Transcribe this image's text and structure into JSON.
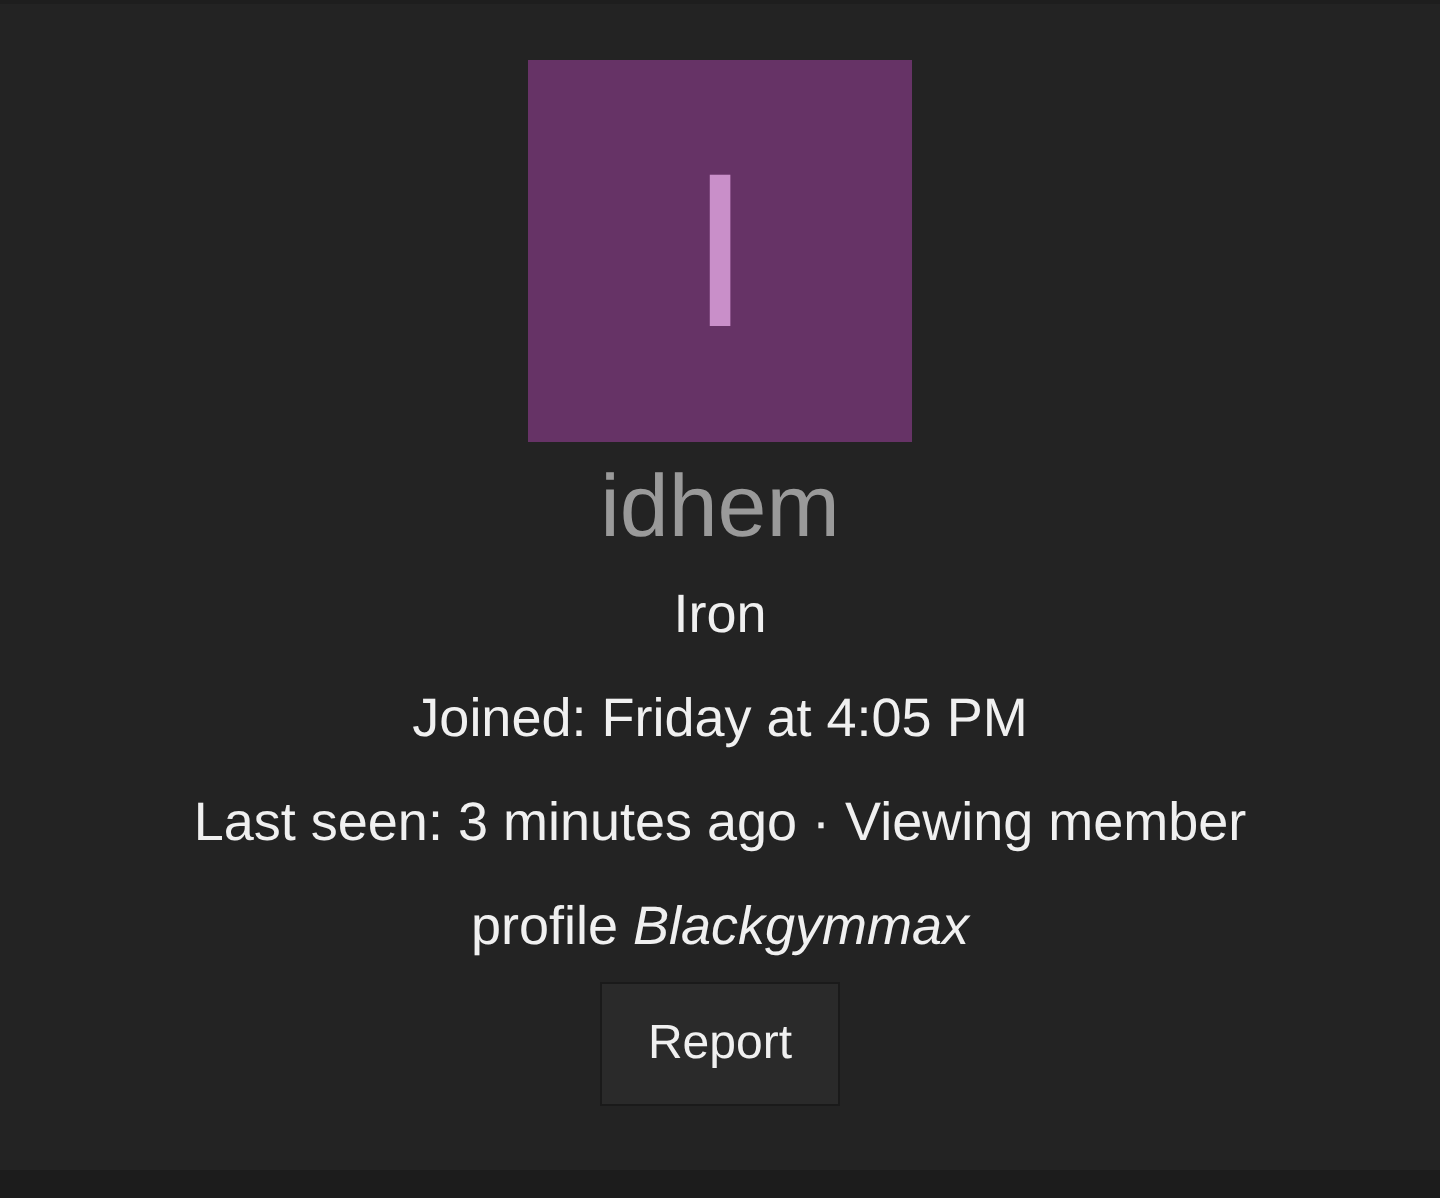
{
  "avatar": {
    "letter": "I",
    "color": "#663366"
  },
  "username": "idhem",
  "rank": "Iron",
  "joined": "Joined: Friday at 4:05 PM",
  "last_seen": "Last seen: 3 minutes ago · Viewing member profile *Blackgymmax*",
  "buttons": [
    {
      "label": "Report"
    }
  ]
}
